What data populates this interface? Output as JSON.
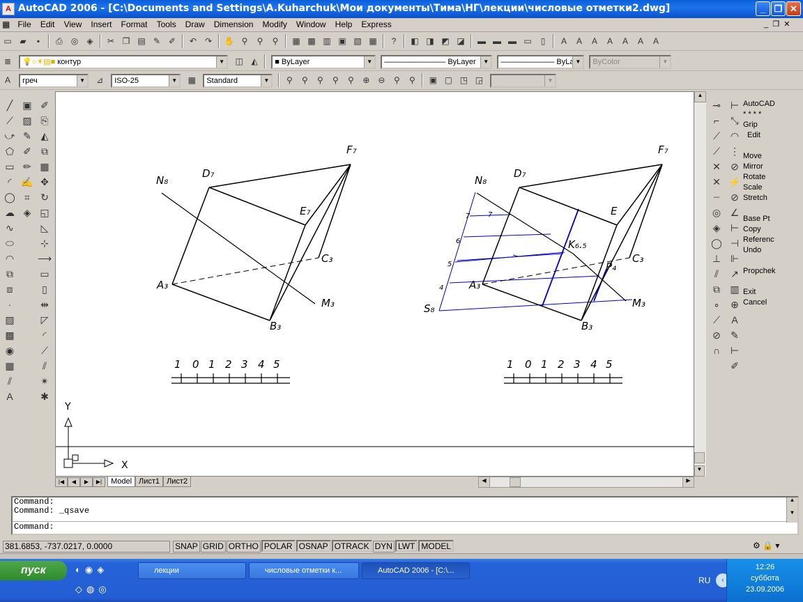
{
  "window": {
    "title": "AutoCAD 2006 - [C:\\Documents and Settings\\A.Kuharchuk\\Мои документы\\Тима\\НГ\\лекции\\числовые отметки2.dwg]",
    "minimize": "_",
    "restore": "❐",
    "close": "✕"
  },
  "menubar": [
    "File",
    "Edit",
    "View",
    "Insert",
    "Format",
    "Tools",
    "Draw",
    "Dimension",
    "Modify",
    "Window",
    "Help",
    "Express"
  ],
  "toolbars": {
    "layer_combo": "контур",
    "color_combo": "ByLayer",
    "linetype_combo": "ByLayer",
    "lineweight_combo": "ByLayer",
    "plotstyle_combo": "ByColor",
    "textstyle_combo": "греч",
    "dimstyle_combo": "ISO-25",
    "tablestyle_combo": "Standard"
  },
  "drawing": {
    "left": {
      "labels": {
        "N": "N₈",
        "D": "D₇",
        "F": "F₇",
        "E": "E₇",
        "C": "C₃",
        "A": "A₃",
        "M": "M₃",
        "B": "B₃"
      },
      "scale_numbers": [
        "1",
        "0",
        "1",
        "2",
        "3",
        "4",
        "5"
      ]
    },
    "right": {
      "labels": {
        "N": "N₈",
        "D": "D₇",
        "F": "F₇",
        "E": "E",
        "C": "C₃",
        "A": "A₃",
        "M": "M₃",
        "B": "B₃",
        "K": "K₆.₅",
        "P": "P₄",
        "S": "S₈"
      },
      "grade_marks": [
        "7",
        "7",
        "6",
        "5",
        "4"
      ],
      "scale_numbers": [
        "1",
        "0",
        "1",
        "2",
        "3",
        "4",
        "5"
      ]
    },
    "ucs": {
      "x": "X",
      "y": "Y"
    }
  },
  "layout_tabs": [
    "Model",
    "Лист1",
    "Лист2"
  ],
  "right_panel": [
    "AutoCAD",
    "* * * *",
    "Grip",
    "Edit",
    "",
    "Move",
    "Mirror",
    "Rotate",
    "Scale",
    "Stretch",
    "",
    "Base Pt",
    "Copy",
    "Referenc",
    "Undo",
    "",
    "Propchek",
    "",
    "Exit",
    "Cancel"
  ],
  "command": {
    "lines": [
      "Command:",
      "Command: _qsave"
    ],
    "prompt": "Command:"
  },
  "status": {
    "coords": "381.6853, -737.0217, 0.0000",
    "buttons": [
      {
        "label": "SNAP",
        "on": false
      },
      {
        "label": "GRID",
        "on": false
      },
      {
        "label": "ORTHO",
        "on": false
      },
      {
        "label": "POLAR",
        "on": true
      },
      {
        "label": "OSNAP",
        "on": true
      },
      {
        "label": "OTRACK",
        "on": true
      },
      {
        "label": "DYN",
        "on": false
      },
      {
        "label": "LWT",
        "on": true
      },
      {
        "label": "MODEL",
        "on": true
      }
    ]
  },
  "taskbar": {
    "start": "пуск",
    "tasks": [
      "лекции",
      "числовые отметки к...",
      "AutoCAD 2006 - [C:\\..."
    ],
    "lang": "RU",
    "time": "12:26",
    "day": "суббота",
    "date": "23.09.2006"
  },
  "colors": {
    "title_blue": "#0a5fd8",
    "grade_blue": "#0000cc",
    "taskbar": "#245ed4",
    "start_green": "#3a9a36"
  }
}
